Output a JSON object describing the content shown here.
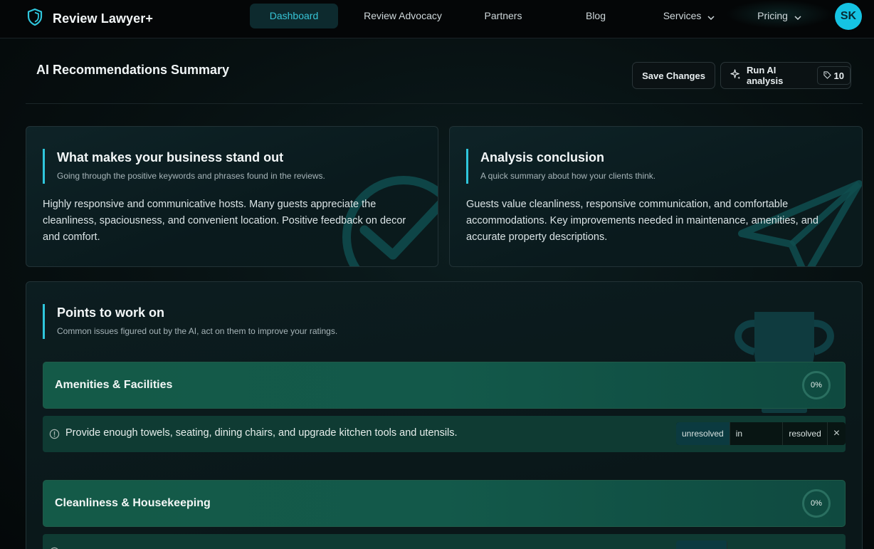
{
  "nav": {
    "brand": "Review Lawyer+",
    "links": [
      {
        "label": "Dashboard",
        "active": true
      },
      {
        "label": "Review Advocacy"
      },
      {
        "label": "Partners"
      },
      {
        "label": "Blog"
      },
      {
        "label": "Services",
        "dropdown": true
      },
      {
        "label": "Pricing",
        "dropdown": true
      }
    ],
    "avatar_initials": "SK"
  },
  "header": {
    "title": "AI Recommendations Summary",
    "save_label": "Save Changes",
    "run_label": "Run AI analysis",
    "credits": "10"
  },
  "standout": {
    "title": "What makes your business stand out",
    "subtitle": "Going through the positive keywords and phrases found in the reviews.",
    "body": "Highly responsive and communicative hosts. Many guests appreciate the cleanliness, spaciousness, and convenient location. Positive feedback on decor and comfort."
  },
  "conclusion": {
    "title": "Analysis conclusion",
    "subtitle": "A quick summary about how your clients think.",
    "body": "Guests value cleanliness, responsive communication, and comfortable accommodations. Key improvements needed in maintenance, amenities, and accurate property descriptions."
  },
  "points": {
    "title": "Points to work on",
    "subtitle": "Common issues figured out by the AI, act on them to improve your ratings.",
    "categories": [
      {
        "title": "Amenities & Facilities",
        "progress": "0%",
        "issue": "Provide enough towels, seating, dining chairs, and upgrade kitchen tools and utensils.",
        "statuses": [
          "unresolved",
          "in progress",
          "resolved"
        ],
        "selected_status": "unresolved"
      },
      {
        "title": "Cleanliness & Housekeeping",
        "progress": "0%"
      }
    ]
  },
  "colors": {
    "accent": "#2fc6dc",
    "avatar": "#15c3e3",
    "category_bg": "#145a48"
  }
}
